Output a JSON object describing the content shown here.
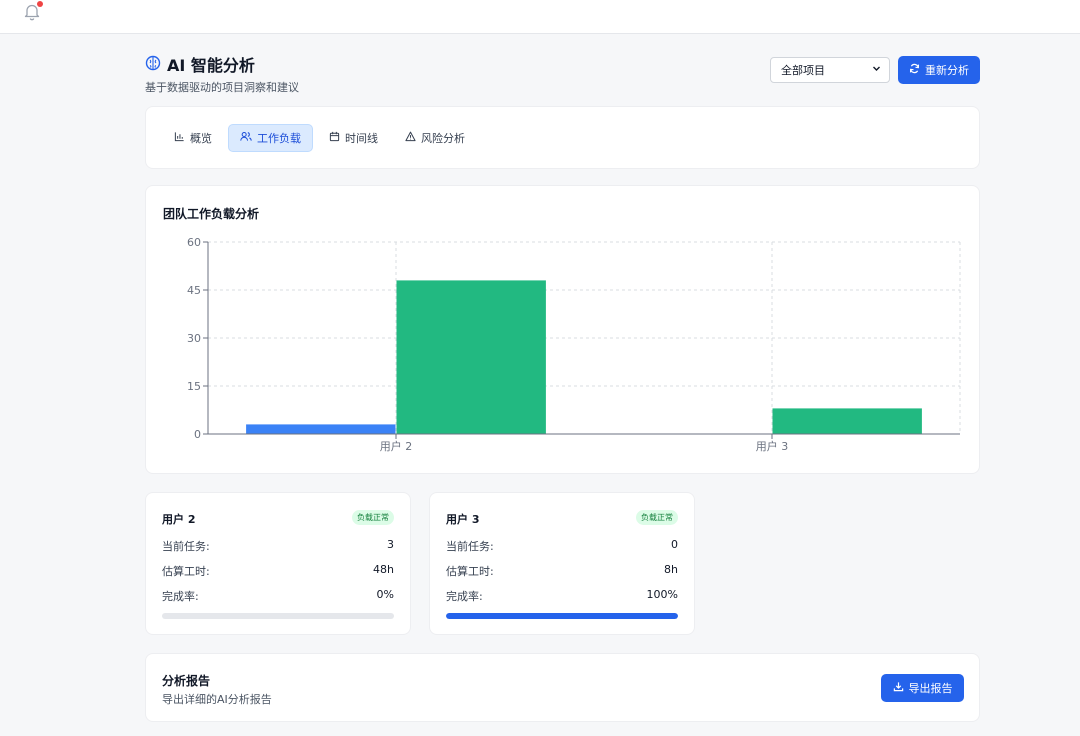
{
  "header": {
    "title": "AI 智能分析",
    "subtitle": "基于数据驱动的项目洞察和建议",
    "project_select": "全部项目",
    "reanalyze_label": "重新分析"
  },
  "tabs": [
    {
      "label": "概览",
      "icon": "bar-chart-icon",
      "active": false
    },
    {
      "label": "工作负载",
      "icon": "users-icon",
      "active": true
    },
    {
      "label": "时间线",
      "icon": "calendar-icon",
      "active": false
    },
    {
      "label": "风险分析",
      "icon": "warning-icon",
      "active": false
    }
  ],
  "workload": {
    "title": "团队工作负载分析"
  },
  "chart_data": {
    "type": "bar",
    "title": "团队工作负载分析",
    "categories": [
      "用户 2",
      "用户 3"
    ],
    "series": [
      {
        "values": [
          3,
          0
        ],
        "color": "#3b82f6"
      },
      {
        "values": [
          48,
          8
        ],
        "color": "#22b981"
      }
    ],
    "yticks": [
      "0",
      "15",
      "30",
      "45",
      "60"
    ],
    "ylim": [
      0,
      60
    ],
    "grid": true,
    "legend": "none"
  },
  "users": [
    {
      "name": "用户 2",
      "badge": "负载正常",
      "tasks_label": "当前任务:",
      "tasks": "3",
      "hours_label": "估算工时:",
      "hours": "48h",
      "completion_label": "完成率:",
      "completion": "0%",
      "completion_value": 0
    },
    {
      "name": "用户 3",
      "badge": "负载正常",
      "tasks_label": "当前任务:",
      "tasks": "0",
      "hours_label": "估算工时:",
      "hours": "8h",
      "completion_label": "完成率:",
      "completion": "100%",
      "completion_value": 100
    }
  ],
  "report": {
    "title": "分析报告",
    "subtitle": "导出详细的AI分析报告",
    "export_label": "导出报告"
  },
  "colors": {
    "primary": "#2563eb",
    "bar_blue": "#3b82f6",
    "bar_green": "#22b981",
    "badge_bg": "#dcfce7",
    "badge_text": "#15803d",
    "notification_dot": "#ef4444"
  }
}
